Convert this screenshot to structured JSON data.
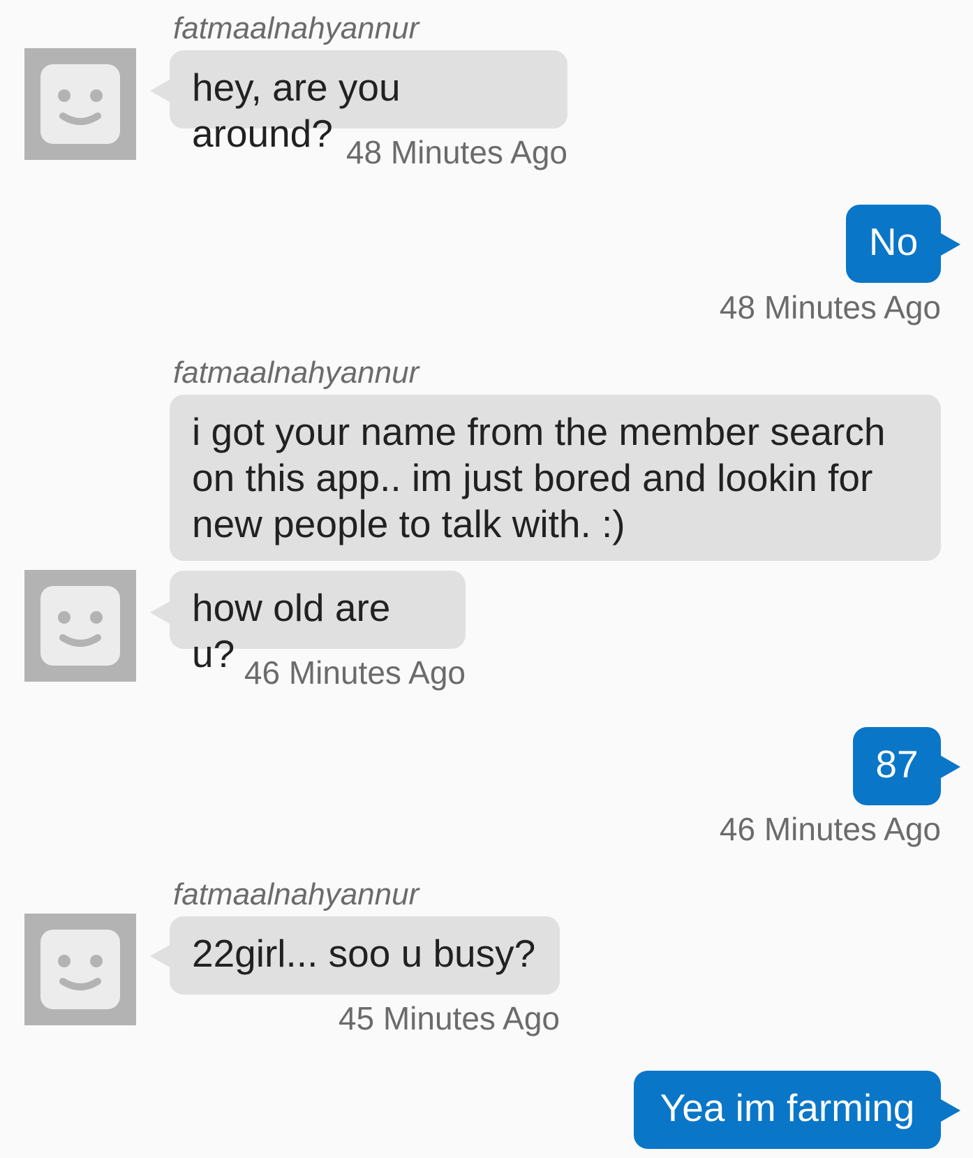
{
  "contact": {
    "name": "fatmaalnahyannur"
  },
  "messages": [
    {
      "from": "them",
      "text": "hey, are you around?",
      "time": "48 Minutes Ago"
    },
    {
      "from": "me",
      "text": "No",
      "time": "48 Minutes Ago"
    },
    {
      "from": "them",
      "text": "i got your name from the member search on this app.. im just bored and lookin for new people to talk with. :)"
    },
    {
      "from": "them",
      "text": "how old are u?",
      "time": "46 Minutes Ago"
    },
    {
      "from": "me",
      "text": "87",
      "time": "46 Minutes Ago"
    },
    {
      "from": "them",
      "text": "22girl... soo u busy?",
      "time": "45 Minutes Ago"
    },
    {
      "from": "me",
      "text": "Yea im farming"
    }
  ],
  "colors": {
    "background": "#fafafa",
    "incoming_bubble": "#e0e0e0",
    "outgoing_bubble": "#0a76c8",
    "avatar_bg": "#b3b3b3",
    "avatar_face": "#ececec",
    "meta_text": "#6b6b6b"
  },
  "icons": {
    "avatar": "smiley-face-avatar-icon"
  }
}
